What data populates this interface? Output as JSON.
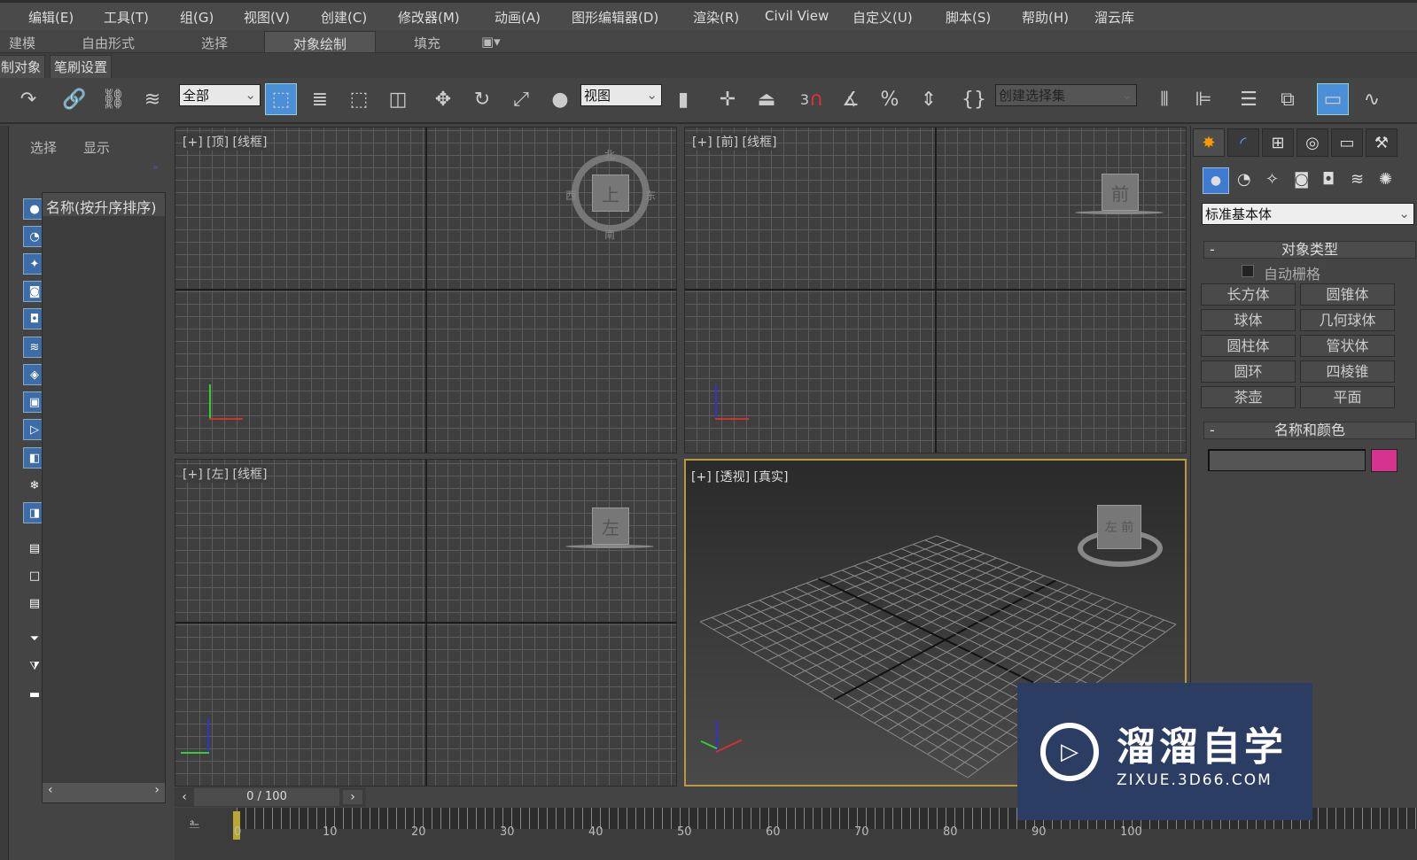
{
  "menu": [
    "编辑(E)",
    "工具(T)",
    "组(G)",
    "视图(V)",
    "创建(C)",
    "修改器(M)",
    "动画(A)",
    "图形编辑器(D)",
    "渲染(R)",
    "Civil View",
    "自定义(U)",
    "脚本(S)",
    "帮助(H)",
    "溜云库"
  ],
  "ribbon": {
    "tabs": [
      "建模",
      "自由形式",
      "选择",
      "对象绘制",
      "填充"
    ],
    "active": "对象绘制"
  },
  "subribbon": [
    "制对象",
    "笔刷设置"
  ],
  "toolbar": {
    "selection_filter": "全部",
    "ref_coord": "视图",
    "snap_angle": "3",
    "named_selection": "创建选择集"
  },
  "scene_explorer": {
    "tabs": [
      "选择",
      "显示"
    ],
    "column": "名称(按升序排序)"
  },
  "viewports": [
    {
      "label": "[+] [顶] [线框]",
      "cube": "上",
      "compass": [
        "北",
        "西",
        "东",
        "南"
      ]
    },
    {
      "label": "[+] [前] [线框]",
      "cube": "前"
    },
    {
      "label": "[+] [左] [线框]",
      "cube": "左"
    },
    {
      "label": "[+] [透视] [真实]",
      "cube": "左 前"
    }
  ],
  "command_panel": {
    "category": "标准基本体",
    "rollout_object_type": "对象类型",
    "autogrid": "自动栅格",
    "autogrid_checked": false,
    "buttons": [
      "长方体",
      "圆锥体",
      "球体",
      "几何球体",
      "圆柱体",
      "管状体",
      "圆环",
      "四棱锥",
      "茶壶",
      "平面"
    ],
    "rollout_name_color": "名称和颜色",
    "name_value": "",
    "object_color": "#d6338f"
  },
  "time_slider": {
    "position": "0 / 100",
    "current": 0,
    "max": 100
  },
  "ruler_ticks": [
    "0",
    "10",
    "20",
    "30",
    "40",
    "50",
    "60",
    "70",
    "80",
    "90",
    "100"
  ],
  "watermark": {
    "title": "溜溜自学",
    "url": "ZIXUE.3D66.COM"
  }
}
